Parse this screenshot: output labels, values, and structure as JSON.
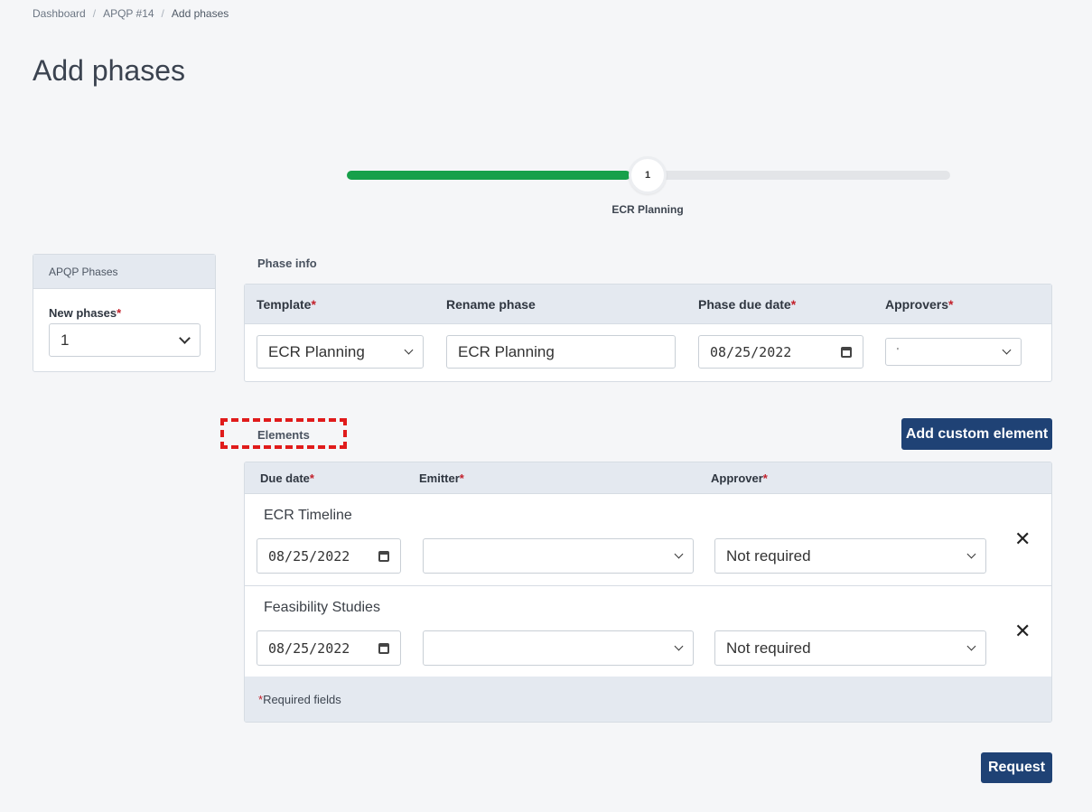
{
  "breadcrumb": {
    "items": [
      "Dashboard",
      "APQP #14"
    ],
    "current": "Add phases"
  },
  "page": {
    "title": "Add phases"
  },
  "stepper": {
    "step_number": "1",
    "step_label": "ECR Planning",
    "progress_fraction": 0.47
  },
  "phases_card": {
    "header": "APQP Phases",
    "new_phases_label": "New phases",
    "new_phases_value": "1"
  },
  "phase_info": {
    "section_label": "Phase info",
    "columns": {
      "template": "Template",
      "rename": "Rename phase",
      "due_date": "Phase due date",
      "approvers": "Approvers"
    },
    "template_value": "ECR Planning",
    "rename_value": "ECR Planning",
    "due_date_value": "08/25/2022",
    "approvers_value": "'"
  },
  "elements": {
    "section_label": "Elements",
    "add_button": "Add custom element",
    "columns": {
      "due_date": "Due date",
      "emitter": "Emitter",
      "approver": "Approver"
    },
    "rows": [
      {
        "name": "ECR Timeline",
        "due_date": "08/25/2022",
        "emitter": "",
        "approver": "Not required"
      },
      {
        "name": "Feasibility Studies",
        "due_date": "08/25/2022",
        "emitter": "",
        "approver": "Not required"
      }
    ],
    "footer_note": "Required fields"
  },
  "required_mark": "*",
  "actions": {
    "request_button": "Request"
  },
  "colors": {
    "primary": "#1f4275",
    "progress": "#17a04a",
    "required": "#c2202b",
    "highlight": "#e01b1b"
  }
}
